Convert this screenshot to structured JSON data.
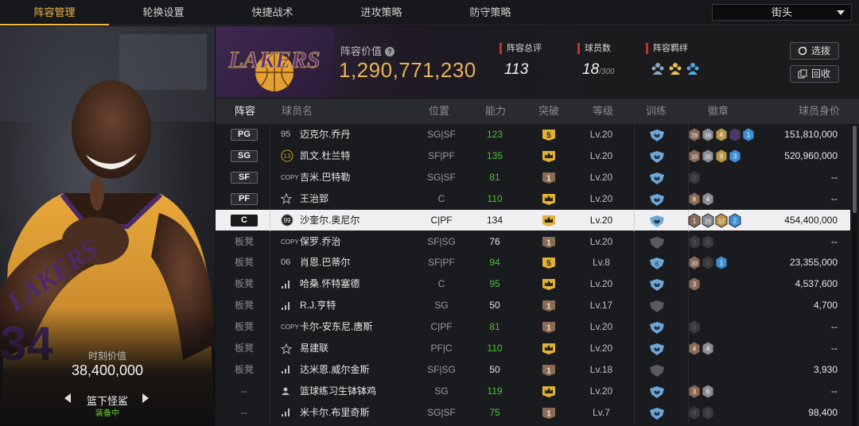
{
  "tabs": [
    "阵容管理",
    "轮换设置",
    "快捷战术",
    "进攻策略",
    "防守策略"
  ],
  "mode": "街头",
  "left_panel": {
    "value_label": "时刻价值",
    "value": "38,400,000",
    "player_name": "篮下怪鲨",
    "equipped": "装备中"
  },
  "header": {
    "lineup_value_label": "阵容价值",
    "lineup_value": "1,290,771,230",
    "total_rating_label": "阵容总评",
    "total_rating": "113",
    "player_count_label": "球员数",
    "player_count": "18",
    "player_count_max": "/300",
    "chemistry_label": "阵容羁绊",
    "select_button": "选拨",
    "recycle_button": "回收"
  },
  "columns": [
    "阵容",
    "球员名",
    "位置",
    "能力",
    "突破",
    "等级",
    "训练",
    "徽章",
    "球员身价"
  ],
  "colors": {
    "accent": "#f0b640",
    "green": "#4fbf3a",
    "selected_row": "#f0f0f2",
    "stat_marker": "#c5312c"
  },
  "players": [
    {
      "slot": "PG",
      "badge_num": "95",
      "icon": "card",
      "name": "迈克尔.乔丹",
      "pos": "SG|SF",
      "ability": "123",
      "green": true,
      "brk": "5",
      "brk_color": "gold",
      "level": "Lv.20",
      "train": "blue",
      "badges": [
        [
          "29",
          "b"
        ],
        [
          "16",
          "s"
        ],
        [
          "4",
          "g"
        ],
        [
          "",
          "p"
        ],
        [
          "1",
          "d"
        ]
      ],
      "value": "151,810,000"
    },
    {
      "slot": "SG",
      "badge_num": "13",
      "icon": "gold",
      "name": "凯文.杜兰特",
      "pos": "SF|PF",
      "ability": "135",
      "green": true,
      "brk": "crown",
      "brk_color": "gold",
      "level": "Lv.20",
      "train": "blue",
      "badges": [
        [
          "10",
          "b"
        ],
        [
          "20",
          "s"
        ],
        [
          "9",
          "g"
        ],
        [
          "3",
          "d"
        ]
      ],
      "value": "520,960,000"
    },
    {
      "slot": "SF",
      "badge_num": "COPY",
      "icon": "copy",
      "name": "吉米.巴特勒",
      "pos": "SG|SF",
      "ability": "81",
      "green": true,
      "brk": "1",
      "brk_color": "bronze",
      "level": "Lv.20",
      "train": "blue",
      "badges": [
        [
          "0",
          "x"
        ]
      ],
      "value": "--"
    },
    {
      "slot": "PF",
      "badge_num": "",
      "icon": "star",
      "name": "王治郅",
      "pos": "C",
      "ability": "110",
      "green": true,
      "brk": "crown",
      "brk_color": "gold",
      "level": "Lv.20",
      "train": "blue",
      "badges": [
        [
          "8",
          "b"
        ],
        [
          "4",
          "s"
        ]
      ],
      "value": "--"
    },
    {
      "slot": "C",
      "badge_num": "99",
      "icon": "ring",
      "name": "沙奎尔.奥尼尔",
      "pos": "C|PF",
      "ability": "134",
      "green": false,
      "brk": "crown",
      "brk_color": "gold",
      "level": "Lv.20",
      "train": "blue",
      "badges": [
        [
          "1",
          "b"
        ],
        [
          "15",
          "s"
        ],
        [
          "12",
          "g"
        ],
        [
          "2",
          "d"
        ]
      ],
      "value": "454,400,000",
      "selected": true
    },
    {
      "slot": "板凳",
      "badge_num": "COPY",
      "icon": "copy",
      "name": "保罗.乔治",
      "pos": "SF|SG",
      "ability": "76",
      "green": false,
      "brk": "1",
      "brk_color": "bronze",
      "level": "Lv.20",
      "train": "grey",
      "badges": [
        [
          "0",
          "x"
        ],
        [
          "0",
          "x"
        ]
      ],
      "value": "--"
    },
    {
      "slot": "板凳",
      "badge_num": "06",
      "icon": "num",
      "name": "肖恩.巴蒂尔",
      "pos": "SF|PF",
      "ability": "94",
      "green": true,
      "brk": "5",
      "brk_color": "gold",
      "level": "Lv.8",
      "train": "blue6",
      "badges": [
        [
          "10",
          "b"
        ],
        [
          "0",
          "x"
        ],
        [
          "1",
          "d"
        ]
      ],
      "value": "23,355,000"
    },
    {
      "slot": "板凳",
      "badge_num": "",
      "icon": "bars",
      "name": "哈桑.怀特塞德",
      "pos": "C",
      "ability": "95",
      "green": true,
      "brk": "crown",
      "brk_color": "gold",
      "level": "Lv.20",
      "train": "blue",
      "badges": [
        [
          "3",
          "b"
        ]
      ],
      "value": "4,537,600"
    },
    {
      "slot": "板凳",
      "badge_num": "",
      "icon": "bars",
      "name": "R.J.亨特",
      "pos": "SG",
      "ability": "50",
      "green": false,
      "brk": "1",
      "brk_color": "bronze",
      "level": "Lv.17",
      "train": "grey",
      "badges": [],
      "value": "4,700"
    },
    {
      "slot": "板凳",
      "badge_num": "COPY",
      "icon": "copy",
      "name": "卡尔-安东尼.唐斯",
      "pos": "C|PF",
      "ability": "81",
      "green": true,
      "brk": "1",
      "brk_color": "bronze",
      "level": "Lv.20",
      "train": "blue",
      "badges": [
        [
          "0",
          "x"
        ]
      ],
      "value": "--"
    },
    {
      "slot": "板凳",
      "badge_num": "",
      "icon": "star",
      "name": "易建联",
      "pos": "PF|C",
      "ability": "110",
      "green": true,
      "brk": "crown",
      "brk_color": "gold",
      "level": "Lv.20",
      "train": "blue",
      "badges": [
        [
          "4",
          "b"
        ],
        [
          "4",
          "s"
        ]
      ],
      "value": "--"
    },
    {
      "slot": "板凳",
      "badge_num": "",
      "icon": "bars",
      "name": "达米恩.威尔金斯",
      "pos": "SF|SG",
      "ability": "50",
      "green": false,
      "brk": "1",
      "brk_color": "bronze",
      "level": "Lv.18",
      "train": "grey",
      "badges": [],
      "value": "3,930"
    },
    {
      "slot": "--",
      "badge_num": "",
      "icon": "person",
      "name": "篮球练习生钵钵鸡",
      "pos": "SG",
      "ability": "119",
      "green": true,
      "brk": "crown",
      "brk_color": "gold",
      "level": "Lv.20",
      "train": "blue",
      "badges": [
        [
          "3",
          "b"
        ],
        [
          "6",
          "s"
        ]
      ],
      "value": "--"
    },
    {
      "slot": "--",
      "badge_num": "",
      "icon": "bars",
      "name": "米卡尔.布里奇斯",
      "pos": "SG|SF",
      "ability": "75",
      "green": true,
      "brk": "1",
      "brk_color": "bronze",
      "level": "Lv.7",
      "train": "blue",
      "badges": [
        [
          "0",
          "x"
        ],
        [
          "0",
          "x"
        ]
      ],
      "value": "98,400"
    }
  ]
}
